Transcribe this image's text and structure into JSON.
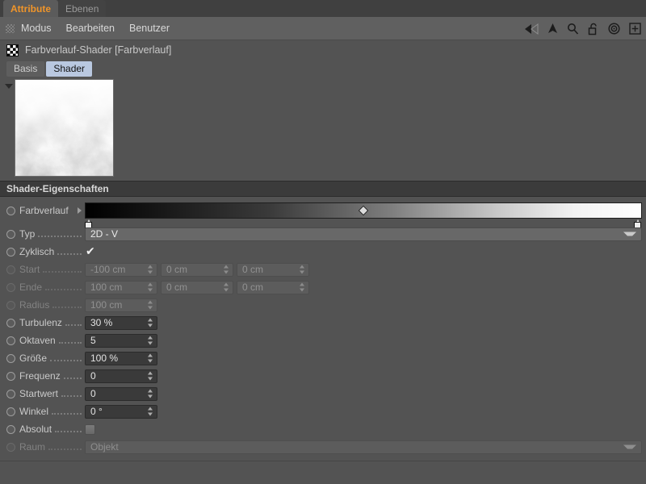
{
  "window": {
    "tabs": [
      {
        "label": "Attribute",
        "active": true
      },
      {
        "label": "Ebenen",
        "active": false
      }
    ],
    "accent_active_tab": "#f0952a",
    "background": "#535353"
  },
  "menubar": {
    "grip_icon": "grip-dots-icon",
    "items": [
      "Modus",
      "Bearbeiten",
      "Benutzer"
    ],
    "icons": [
      "back-arrow-icon",
      "forward-arrow-icon",
      "up-arrow-icon",
      "search-icon",
      "unlock-padlock-icon",
      "target-icon",
      "plus-box-icon"
    ]
  },
  "object": {
    "icon": "gradient-checker-icon",
    "title": "Farbverlauf-Shader [Farbverlauf]"
  },
  "subtabs": [
    {
      "label": "Basis",
      "active": false
    },
    {
      "label": "Shader",
      "active": true
    }
  ],
  "preview": {
    "collapse_icon": "collapse-triangle-icon",
    "description": "turbulence-noise-gradient-preview"
  },
  "section": {
    "title": "Shader-Eigenschaften"
  },
  "parameters": {
    "gradient": {
      "label": "Farbverlauf",
      "expand_icon": "expand-arrow-icon",
      "stops": [
        {
          "position": 0,
          "color": "#000000"
        },
        {
          "position": 100,
          "color": "#ffffff"
        }
      ],
      "interpolation_handle": 50
    },
    "typ": {
      "label": "Typ",
      "value": "2D - V",
      "enabled": true
    },
    "zyklisch": {
      "label": "Zyklisch",
      "checked": true,
      "enabled": true
    },
    "start": {
      "label": "Start",
      "enabled": false,
      "values": [
        "-100 cm",
        "0 cm",
        "0 cm"
      ]
    },
    "ende": {
      "label": "Ende",
      "enabled": false,
      "values": [
        "100 cm",
        "0 cm",
        "0 cm"
      ]
    },
    "radius": {
      "label": "Radius",
      "enabled": false,
      "values": [
        "100 cm"
      ]
    },
    "turbulenz": {
      "label": "Turbulenz",
      "enabled": true,
      "values": [
        "30 %"
      ]
    },
    "oktaven": {
      "label": "Oktaven",
      "enabled": true,
      "values": [
        "5"
      ]
    },
    "groesse": {
      "label": "Größe",
      "enabled": true,
      "values": [
        "100 %"
      ]
    },
    "frequenz": {
      "label": "Frequenz",
      "enabled": true,
      "values": [
        "0"
      ]
    },
    "startwert": {
      "label": "Startwert",
      "enabled": true,
      "values": [
        "0"
      ]
    },
    "winkel": {
      "label": "Winkel",
      "enabled": true,
      "values": [
        "0 °"
      ]
    },
    "absolut": {
      "label": "Absolut",
      "checked": false,
      "enabled": true
    },
    "raum": {
      "label": "Raum",
      "value": "Objekt",
      "enabled": false
    }
  }
}
